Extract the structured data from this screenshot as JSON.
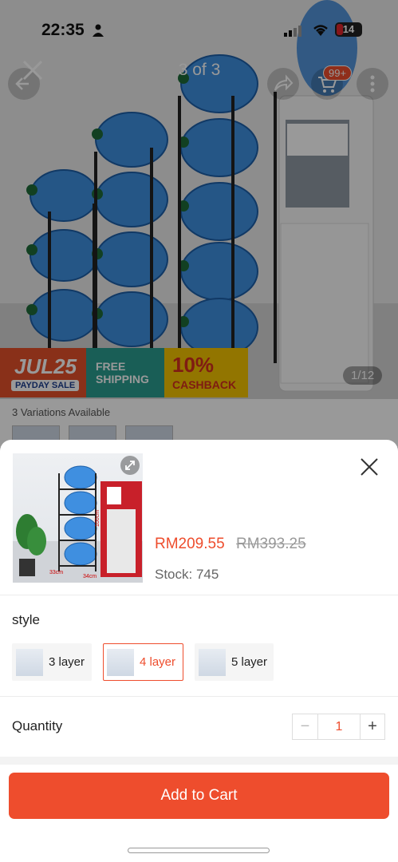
{
  "status_bar": {
    "time": "22:35",
    "battery": "14"
  },
  "gallery": {
    "counter": "3 of 3",
    "pager": "1/12",
    "cart_badge": "99+",
    "promo": {
      "sale_title": "JUL25",
      "sale_sub": "PAYDAY SALE",
      "shipping": "FREE SHIPPING",
      "cashback_pct": "10%",
      "cashback": "CASHBACK"
    },
    "variations_text": "3 Variations Available"
  },
  "sheet": {
    "price": "RM209.55",
    "original_price": "RM393.25",
    "stock_label": "Stock: ",
    "stock_value": "745",
    "style_label": "style",
    "options": [
      {
        "label": "3 layer",
        "selected": false
      },
      {
        "label": "4 layer",
        "selected": true
      },
      {
        "label": "5 layer",
        "selected": false
      }
    ],
    "dimension_labels": [
      "33cm",
      "34cm",
      "100cm"
    ],
    "quantity_label": "Quantity",
    "quantity_value": "1",
    "minus": "−",
    "plus": "+",
    "add_to_cart": "Add to Cart"
  },
  "colors": {
    "accent": "#ee4d2d",
    "overlay": "rgba(0,0,0,0.40)"
  }
}
